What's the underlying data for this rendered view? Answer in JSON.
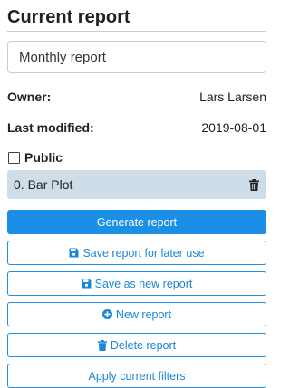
{
  "panel": {
    "title": "Current report",
    "report_name": "Monthly report",
    "owner_label": "Owner:",
    "owner_value": "Lars Larsen",
    "modified_label": "Last modified:",
    "modified_value": "2019-08-01",
    "public_label": "Public",
    "public_checked": false,
    "plots": [
      {
        "label": "0. Bar Plot",
        "icon": "trash-icon"
      }
    ]
  },
  "buttons": {
    "generate": "Generate report",
    "save_later": "Save report for later use",
    "save_new": "Save as new report",
    "new_report": "New report",
    "delete": "Delete report",
    "apply_filters": "Apply current filters"
  },
  "icons": {
    "save_later": "save-icon",
    "save_new": "save-icon",
    "new_report": "plus-circle-icon",
    "delete": "trash-icon"
  },
  "colors": {
    "accent": "#1b8fe6",
    "plot_item_bg": "#cfdde8"
  }
}
